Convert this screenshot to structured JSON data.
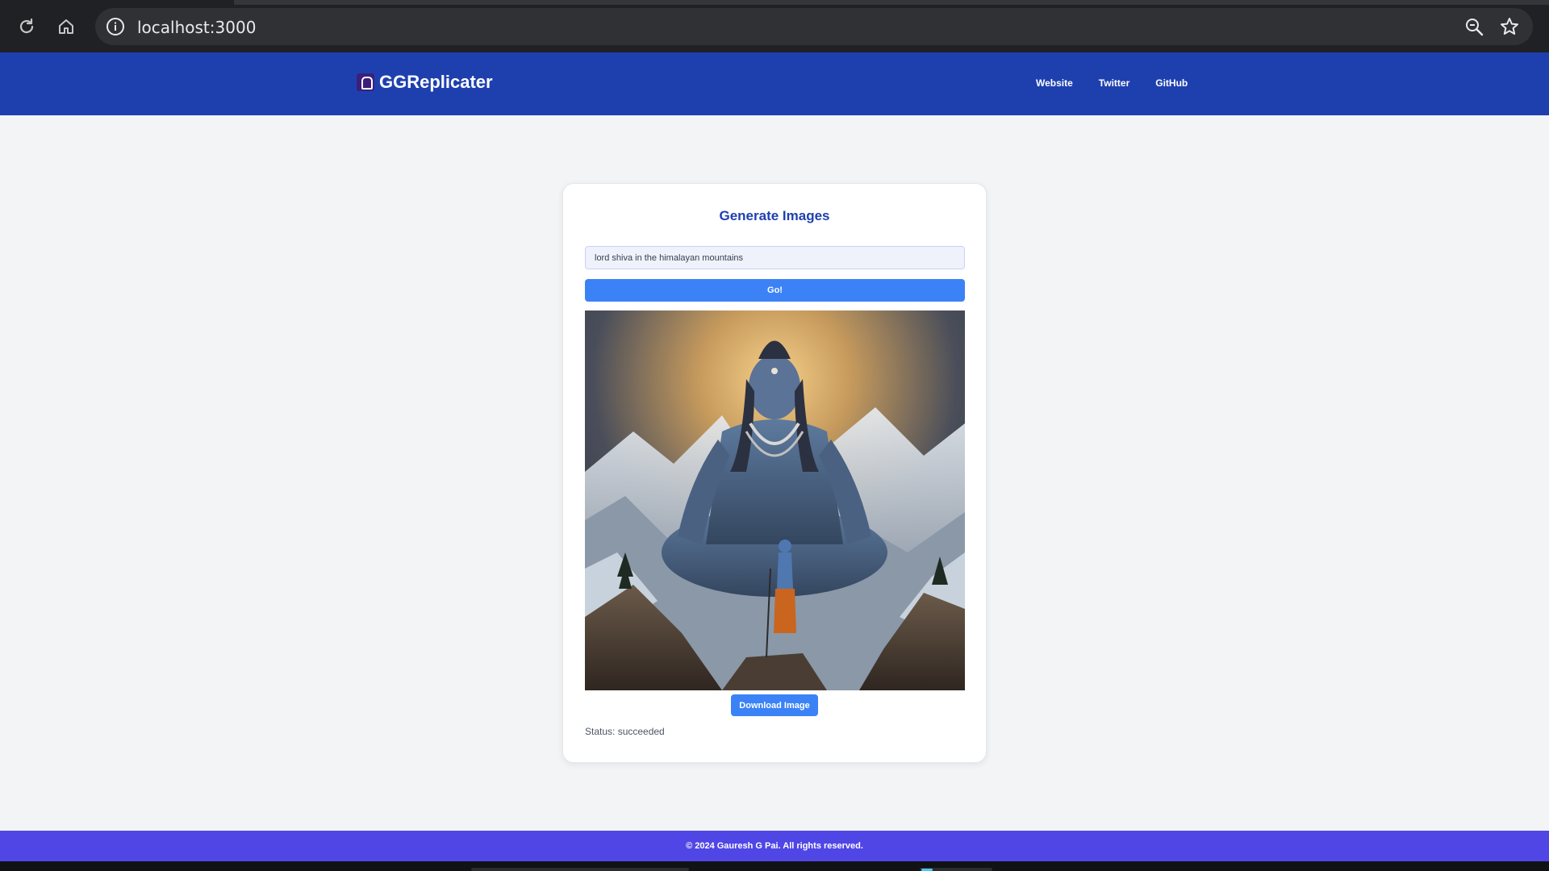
{
  "browser": {
    "url": "localhost:3000",
    "icons": [
      "reload-icon",
      "home-icon",
      "info-icon",
      "zoom-icon",
      "star-icon"
    ]
  },
  "header": {
    "brand": "GGReplicater",
    "nav": [
      {
        "label": "Website"
      },
      {
        "label": "Twitter"
      },
      {
        "label": "GitHub"
      }
    ]
  },
  "card": {
    "title": "Generate Images",
    "prompt_value": "lord shiva in the himalayan mountains",
    "go_label": "Go!",
    "download_label": "Download Image",
    "status": "Status: succeeded"
  },
  "footer": {
    "text": "© 2024 Gauresh G Pai. All rights reserved."
  },
  "colors": {
    "header_bg": "#1e40af",
    "button_bg": "#3b82f6",
    "footer_bg": "#4f46e5",
    "page_bg": "#f3f4f6"
  }
}
